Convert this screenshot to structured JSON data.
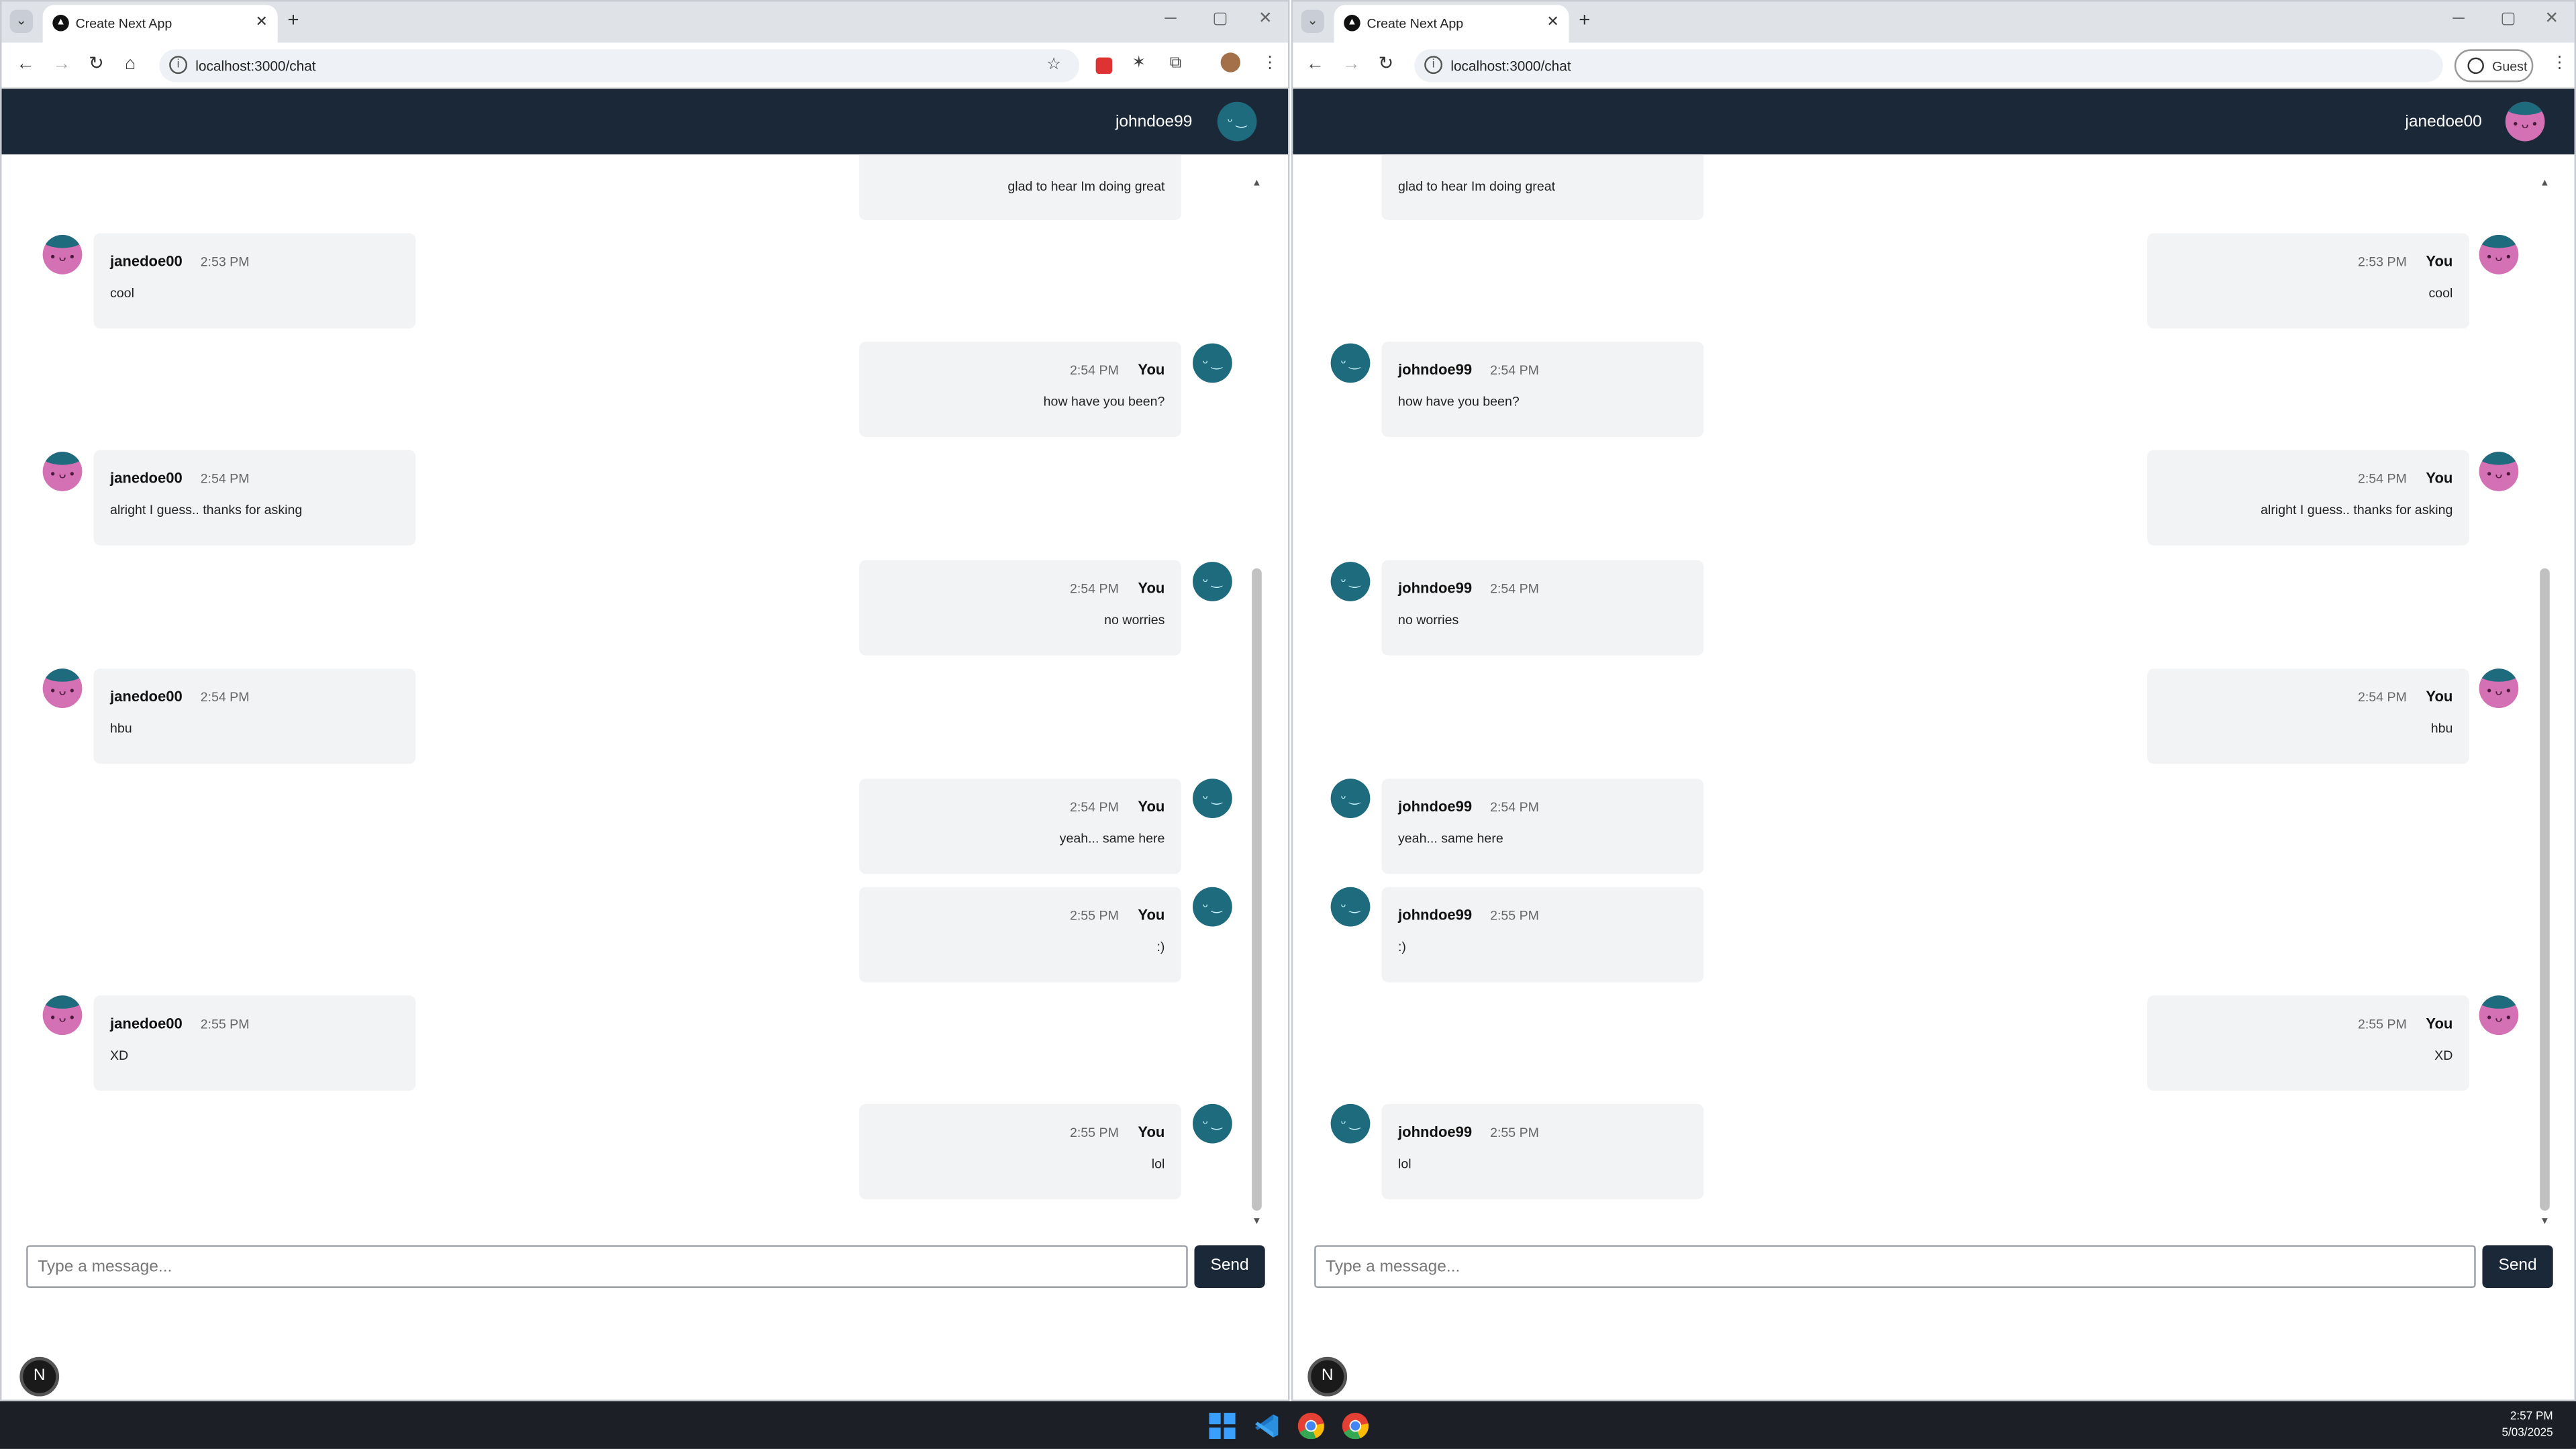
{
  "left_window": {
    "tab_title": "Create Next App",
    "url": "localhost:3000/chat",
    "header_username": "johndoe99",
    "messages": [
      {
        "side": "out",
        "text": "glad to hear Im doing great",
        "time": "",
        "name": ""
      },
      {
        "side": "in",
        "name": "janedoe00",
        "time": "2:53 PM",
        "text": "cool"
      },
      {
        "side": "out",
        "name": "You",
        "time": "2:54 PM",
        "text": "how have you been?"
      },
      {
        "side": "in",
        "name": "janedoe00",
        "time": "2:54 PM",
        "text": "alright I guess.. thanks for asking"
      },
      {
        "side": "out",
        "name": "You",
        "time": "2:54 PM",
        "text": "no worries"
      },
      {
        "side": "in",
        "name": "janedoe00",
        "time": "2:54 PM",
        "text": "hbu"
      },
      {
        "side": "out",
        "name": "You",
        "time": "2:54 PM",
        "text": "yeah... same here"
      },
      {
        "side": "out",
        "name": "You",
        "time": "2:55 PM",
        "text": ":)"
      },
      {
        "side": "in",
        "name": "janedoe00",
        "time": "2:55 PM",
        "text": "XD"
      },
      {
        "side": "out",
        "name": "You",
        "time": "2:55 PM",
        "text": "lol"
      }
    ],
    "input_placeholder": "Type a message...",
    "send_label": "Send"
  },
  "right_window": {
    "tab_title": "Create Next App",
    "url": "localhost:3000/chat",
    "guest_label": "Guest",
    "header_username": "janedoe00",
    "messages": [
      {
        "side": "in",
        "text": "glad to hear Im doing great",
        "time": "",
        "name": ""
      },
      {
        "side": "out",
        "name": "You",
        "time": "2:53 PM",
        "text": "cool"
      },
      {
        "side": "in",
        "name": "johndoe99",
        "time": "2:54 PM",
        "text": "how have you been?"
      },
      {
        "side": "out",
        "name": "You",
        "time": "2:54 PM",
        "text": "alright I guess.. thanks for asking"
      },
      {
        "side": "in",
        "name": "johndoe99",
        "time": "2:54 PM",
        "text": "no worries"
      },
      {
        "side": "out",
        "name": "You",
        "time": "2:54 PM",
        "text": "hbu"
      },
      {
        "side": "in",
        "name": "johndoe99",
        "time": "2:54 PM",
        "text": "yeah... same here"
      },
      {
        "side": "in",
        "name": "johndoe99",
        "time": "2:55 PM",
        "text": ":)"
      },
      {
        "side": "out",
        "name": "You",
        "time": "2:55 PM",
        "text": "XD"
      },
      {
        "side": "in",
        "name": "johndoe99",
        "time": "2:55 PM",
        "text": "lol"
      }
    ],
    "input_placeholder": "Type a message...",
    "send_label": "Send"
  },
  "taskbar": {
    "time": "2:57 PM",
    "date": "5/03/2025"
  },
  "next_badge": "N",
  "colors": {
    "header_bg": "#1b2837",
    "bubble_bg": "#f2f3f5",
    "john_avatar": "#1e6b7d",
    "jane_avatar": "#d471b5"
  }
}
